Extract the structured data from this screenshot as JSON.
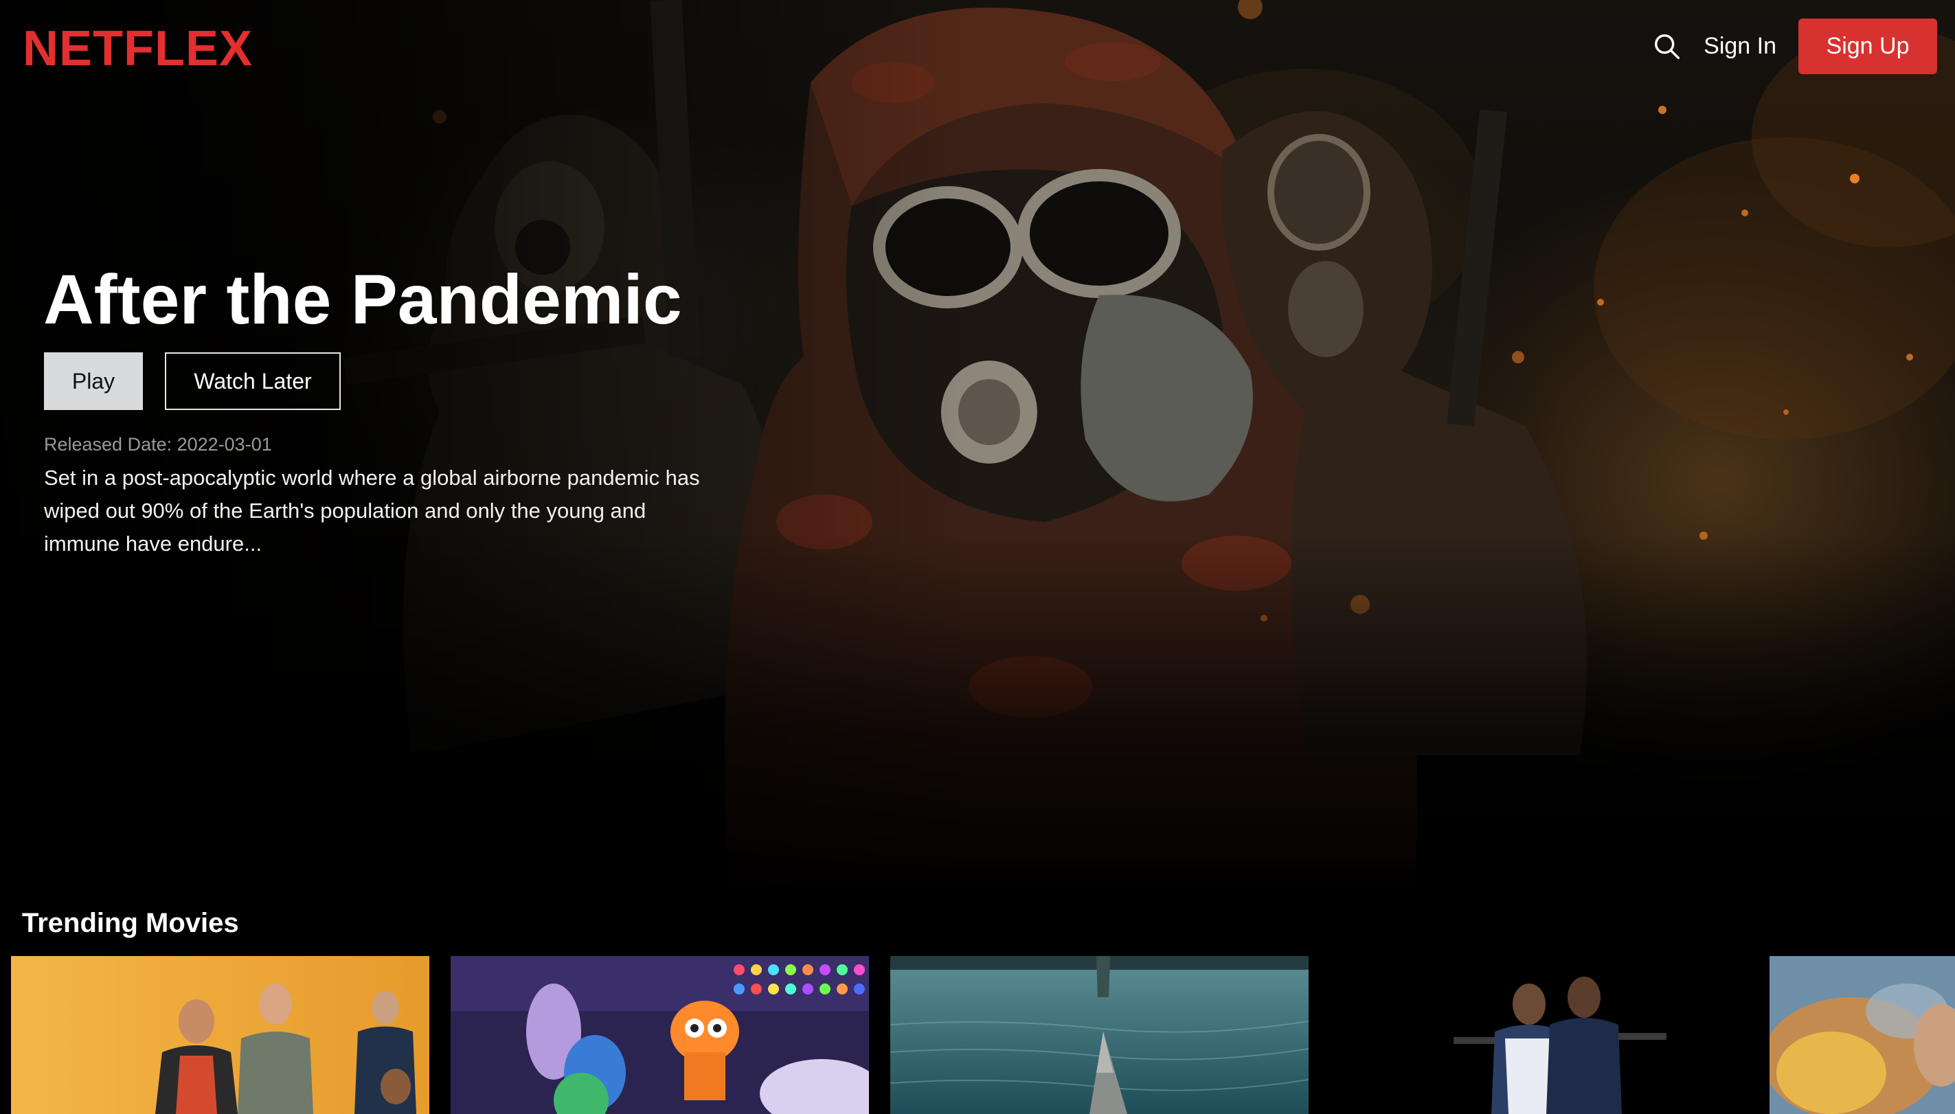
{
  "nav": {
    "logo": "NETFLEX",
    "search_icon": "search-icon",
    "sign_in": "Sign In",
    "sign_up": "Sign Up"
  },
  "colors": {
    "brand": "#e32f2f",
    "signup_bg": "#d7322f",
    "play_bg": "#d9dadc",
    "page_bg": "#000000"
  },
  "hero": {
    "title": "After the Pandemic",
    "play_label": "Play",
    "watch_later_label": "Watch Later",
    "released": "Released Date: 2022-03-01",
    "overview": "Set in a post-apocalyptic world where a global airborne pandemic has wiped out 90% of the Earth's population and only the young and immune have endure..."
  },
  "trending": {
    "title": "Trending Movies",
    "posters": [
      {
        "name": "poster-1"
      },
      {
        "name": "poster-2"
      },
      {
        "name": "poster-3"
      },
      {
        "name": "poster-4"
      },
      {
        "name": "poster-5"
      }
    ]
  }
}
